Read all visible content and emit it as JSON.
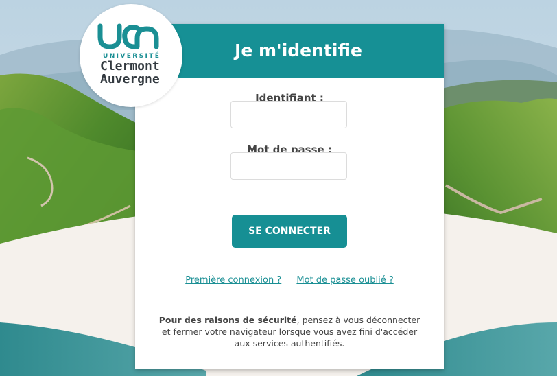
{
  "logo": {
    "mark": "uca",
    "universite": "UNIVERSITÉ",
    "line1": "Clermont",
    "line2": "Auvergne"
  },
  "card": {
    "title": "Je m'identifie",
    "identifiant_label": "Identifiant :",
    "identifiant_value": "",
    "password_label": "Mot de passe :",
    "password_value": "",
    "submit_label": "SE CONNECTER",
    "link_first": "Première connexion ?",
    "link_forgot": "Mot de passe oublié ?",
    "notice_bold": "Pour des raisons de sécurité",
    "notice_rest": ", pensez à vous déconnecter et fermer votre navigateur lorsque vous avez fini d'accéder aux services authentifiés."
  },
  "colors": {
    "brand": "#169095",
    "text": "#444444"
  }
}
